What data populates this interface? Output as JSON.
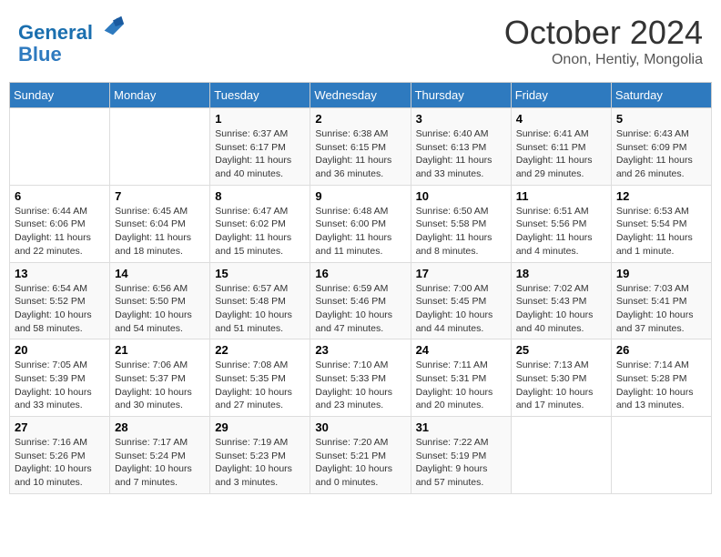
{
  "header": {
    "logo_line1": "General",
    "logo_line2": "Blue",
    "month": "October 2024",
    "location": "Onon, Hentiy, Mongolia"
  },
  "weekdays": [
    "Sunday",
    "Monday",
    "Tuesday",
    "Wednesday",
    "Thursday",
    "Friday",
    "Saturday"
  ],
  "weeks": [
    [
      {
        "day": "",
        "info": ""
      },
      {
        "day": "",
        "info": ""
      },
      {
        "day": "1",
        "info": "Sunrise: 6:37 AM\nSunset: 6:17 PM\nDaylight: 11 hours and 40 minutes."
      },
      {
        "day": "2",
        "info": "Sunrise: 6:38 AM\nSunset: 6:15 PM\nDaylight: 11 hours and 36 minutes."
      },
      {
        "day": "3",
        "info": "Sunrise: 6:40 AM\nSunset: 6:13 PM\nDaylight: 11 hours and 33 minutes."
      },
      {
        "day": "4",
        "info": "Sunrise: 6:41 AM\nSunset: 6:11 PM\nDaylight: 11 hours and 29 minutes."
      },
      {
        "day": "5",
        "info": "Sunrise: 6:43 AM\nSunset: 6:09 PM\nDaylight: 11 hours and 26 minutes."
      }
    ],
    [
      {
        "day": "6",
        "info": "Sunrise: 6:44 AM\nSunset: 6:06 PM\nDaylight: 11 hours and 22 minutes."
      },
      {
        "day": "7",
        "info": "Sunrise: 6:45 AM\nSunset: 6:04 PM\nDaylight: 11 hours and 18 minutes."
      },
      {
        "day": "8",
        "info": "Sunrise: 6:47 AM\nSunset: 6:02 PM\nDaylight: 11 hours and 15 minutes."
      },
      {
        "day": "9",
        "info": "Sunrise: 6:48 AM\nSunset: 6:00 PM\nDaylight: 11 hours and 11 minutes."
      },
      {
        "day": "10",
        "info": "Sunrise: 6:50 AM\nSunset: 5:58 PM\nDaylight: 11 hours and 8 minutes."
      },
      {
        "day": "11",
        "info": "Sunrise: 6:51 AM\nSunset: 5:56 PM\nDaylight: 11 hours and 4 minutes."
      },
      {
        "day": "12",
        "info": "Sunrise: 6:53 AM\nSunset: 5:54 PM\nDaylight: 11 hours and 1 minute."
      }
    ],
    [
      {
        "day": "13",
        "info": "Sunrise: 6:54 AM\nSunset: 5:52 PM\nDaylight: 10 hours and 58 minutes."
      },
      {
        "day": "14",
        "info": "Sunrise: 6:56 AM\nSunset: 5:50 PM\nDaylight: 10 hours and 54 minutes."
      },
      {
        "day": "15",
        "info": "Sunrise: 6:57 AM\nSunset: 5:48 PM\nDaylight: 10 hours and 51 minutes."
      },
      {
        "day": "16",
        "info": "Sunrise: 6:59 AM\nSunset: 5:46 PM\nDaylight: 10 hours and 47 minutes."
      },
      {
        "day": "17",
        "info": "Sunrise: 7:00 AM\nSunset: 5:45 PM\nDaylight: 10 hours and 44 minutes."
      },
      {
        "day": "18",
        "info": "Sunrise: 7:02 AM\nSunset: 5:43 PM\nDaylight: 10 hours and 40 minutes."
      },
      {
        "day": "19",
        "info": "Sunrise: 7:03 AM\nSunset: 5:41 PM\nDaylight: 10 hours and 37 minutes."
      }
    ],
    [
      {
        "day": "20",
        "info": "Sunrise: 7:05 AM\nSunset: 5:39 PM\nDaylight: 10 hours and 33 minutes."
      },
      {
        "day": "21",
        "info": "Sunrise: 7:06 AM\nSunset: 5:37 PM\nDaylight: 10 hours and 30 minutes."
      },
      {
        "day": "22",
        "info": "Sunrise: 7:08 AM\nSunset: 5:35 PM\nDaylight: 10 hours and 27 minutes."
      },
      {
        "day": "23",
        "info": "Sunrise: 7:10 AM\nSunset: 5:33 PM\nDaylight: 10 hours and 23 minutes."
      },
      {
        "day": "24",
        "info": "Sunrise: 7:11 AM\nSunset: 5:31 PM\nDaylight: 10 hours and 20 minutes."
      },
      {
        "day": "25",
        "info": "Sunrise: 7:13 AM\nSunset: 5:30 PM\nDaylight: 10 hours and 17 minutes."
      },
      {
        "day": "26",
        "info": "Sunrise: 7:14 AM\nSunset: 5:28 PM\nDaylight: 10 hours and 13 minutes."
      }
    ],
    [
      {
        "day": "27",
        "info": "Sunrise: 7:16 AM\nSunset: 5:26 PM\nDaylight: 10 hours and 10 minutes."
      },
      {
        "day": "28",
        "info": "Sunrise: 7:17 AM\nSunset: 5:24 PM\nDaylight: 10 hours and 7 minutes."
      },
      {
        "day": "29",
        "info": "Sunrise: 7:19 AM\nSunset: 5:23 PM\nDaylight: 10 hours and 3 minutes."
      },
      {
        "day": "30",
        "info": "Sunrise: 7:20 AM\nSunset: 5:21 PM\nDaylight: 10 hours and 0 minutes."
      },
      {
        "day": "31",
        "info": "Sunrise: 7:22 AM\nSunset: 5:19 PM\nDaylight: 9 hours and 57 minutes."
      },
      {
        "day": "",
        "info": ""
      },
      {
        "day": "",
        "info": ""
      }
    ]
  ]
}
